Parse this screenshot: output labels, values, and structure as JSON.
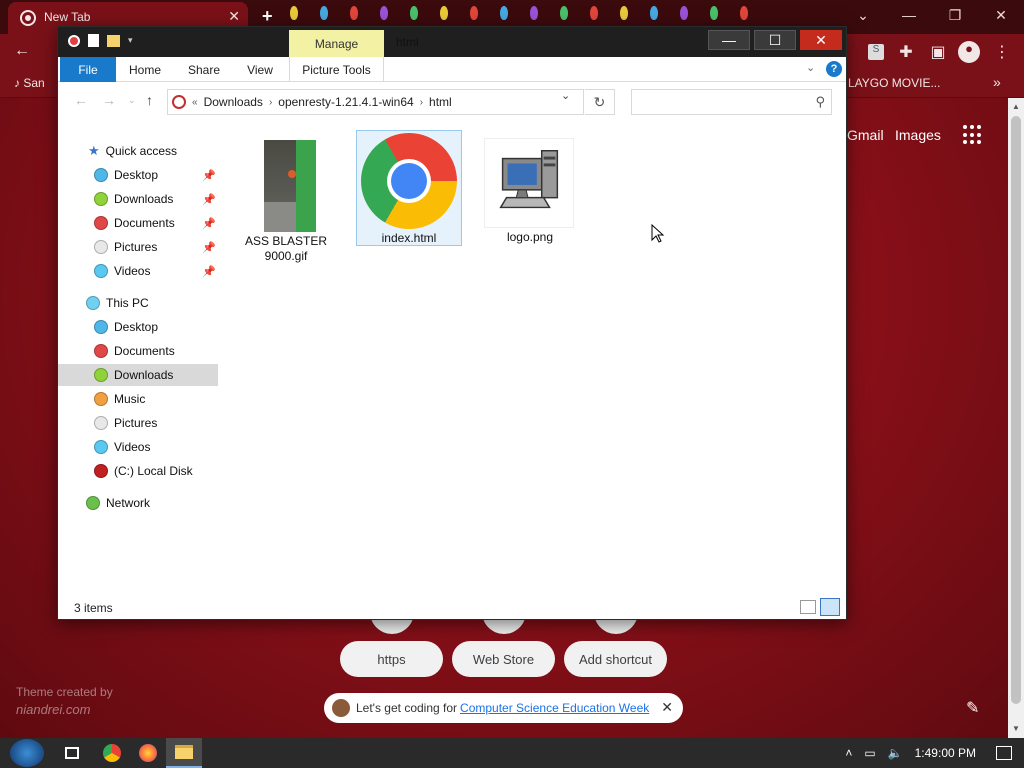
{
  "chrome": {
    "tab_title": "New Tab",
    "bookmark_left": "San",
    "bookmark_right": "LAYGO MOVIE...",
    "gmail": "Gmail",
    "images": "Images",
    "shortcuts": [
      "https",
      "Web Store",
      "Add shortcut"
    ],
    "promo_text": "Let's get coding for",
    "promo_link": "Computer Science Education Week",
    "theme_credit_line1": "Theme created by",
    "theme_credit_line2": "niandrei.com",
    "profile_initial": "S"
  },
  "explorer": {
    "manage_label": "Manage",
    "window_title": "html",
    "ribbon_tabs": [
      "File",
      "Home",
      "Share",
      "View",
      "Picture Tools"
    ],
    "breadcrumb": [
      "Downloads",
      "openresty-1.21.4.1-win64",
      "html"
    ],
    "breadcrumb_prefix": "«",
    "search_placeholder": "",
    "nav": {
      "quick_access": "Quick access",
      "quick_items": [
        "Desktop",
        "Downloads",
        "Documents",
        "Pictures",
        "Videos"
      ],
      "this_pc": "This PC",
      "pc_items": [
        "Desktop",
        "Documents",
        "Downloads",
        "Music",
        "Pictures",
        "Videos",
        "(C:) Local Disk"
      ],
      "network": "Network",
      "selected": "Downloads"
    },
    "files": [
      {
        "name_line1": "ASS BLASTER",
        "name_line2": "9000.gif",
        "type": "gif"
      },
      {
        "name_line1": "index.html",
        "name_line2": "",
        "type": "html"
      },
      {
        "name_line1": "logo.png",
        "name_line2": "",
        "type": "png"
      }
    ],
    "status": "3 items"
  },
  "taskbar": {
    "time": "1:49:00 PM"
  },
  "colors": {
    "file_tab": "#1979ca",
    "manage_tab": "#f3f1a3",
    "close_btn": "#c42b1c",
    "selected_nav": "#d9d9d9",
    "chrome_bg": "#8b1019"
  }
}
